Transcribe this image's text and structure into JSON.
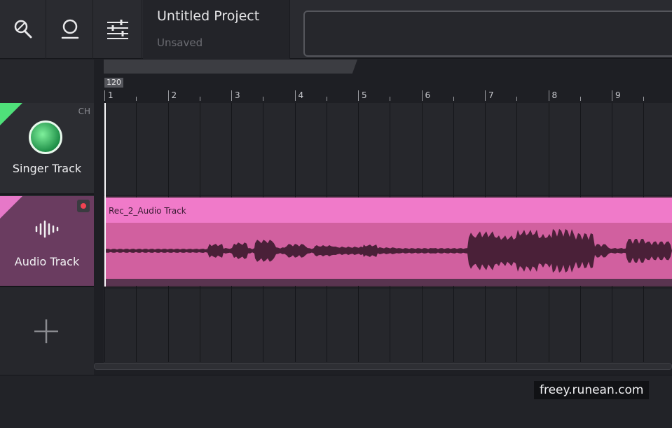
{
  "toolbar": {
    "icons": [
      "mic-search-icon",
      "user-icon",
      "mixer-sliders-icon"
    ]
  },
  "project": {
    "title": "Untitled Project",
    "status": "Unsaved"
  },
  "timeline": {
    "tempo": "120",
    "bars": [
      "1",
      "2",
      "3",
      "4",
      "5",
      "6",
      "7",
      "8",
      "9"
    ]
  },
  "tracks": [
    {
      "name": "Singer Track",
      "type_label": "CH",
      "color": "#4fe07a",
      "icon": "singer-avatar-icon"
    },
    {
      "name": "Audio Track",
      "color": "#e678c8",
      "icon": "waveform-icon",
      "record_armed": true
    }
  ],
  "clip": {
    "name": "Rec_2_Audio Track",
    "color": "#f07ac9"
  },
  "add_track_icon": "plus-icon",
  "watermark": "freey.runean.com"
}
